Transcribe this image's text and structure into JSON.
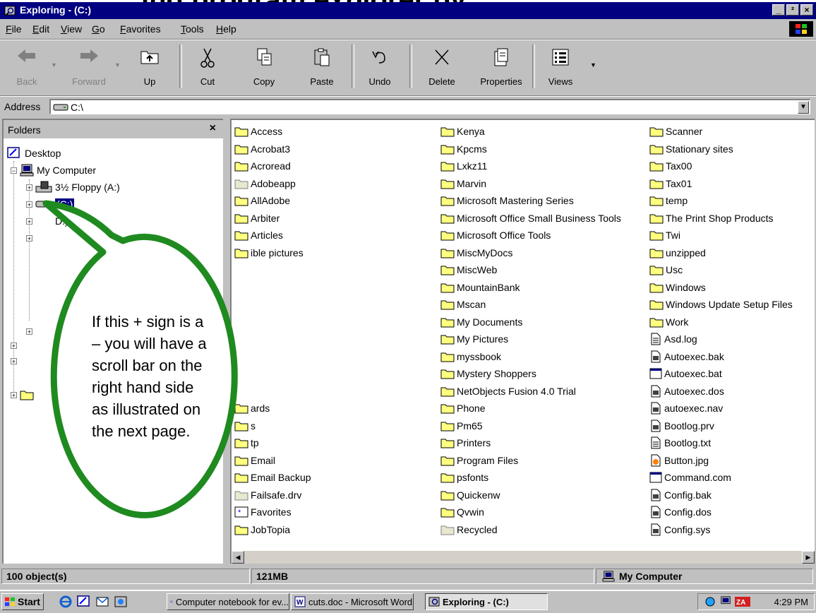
{
  "slide_heading_fragment": "ing program explorer by",
  "window": {
    "title": "Exploring -  (C:)",
    "controls": [
      "_",
      "²",
      "×"
    ]
  },
  "menu": [
    {
      "label": "File",
      "key": "F",
      "rest": "ile"
    },
    {
      "label": "Edit",
      "key": "E",
      "rest": "dit"
    },
    {
      "label": "View",
      "key": "V",
      "rest": "iew"
    },
    {
      "label": "Go",
      "key": "G",
      "rest": "o"
    },
    {
      "label": "Favorites",
      "key": "F",
      "rest": "avorites"
    },
    {
      "label": "Tools",
      "key": "T",
      "rest": "ools"
    },
    {
      "label": "Help",
      "key": "H",
      "rest": "elp"
    }
  ],
  "toolbar": {
    "back": "Back",
    "forward": "Forward",
    "up": "Up",
    "cut": "Cut",
    "copy": "Copy",
    "paste": "Paste",
    "undo": "Undo",
    "delete": "Delete",
    "properties": "Properties",
    "views": "Views"
  },
  "address": {
    "label": "Address",
    "value": "C:\\"
  },
  "folders": {
    "header": "Folders",
    "close": "×",
    "desktop": "Desktop",
    "my_computer": "My Computer",
    "floppy": "3½ Floppy (A:)",
    "c_drive": "(C:)",
    "d_drive_partial": "D:)"
  },
  "files": {
    "col1": [
      "Access",
      "Acrobat3",
      "Acroread",
      "Adobeapp",
      "AllAdobe",
      "Arbiter",
      "Articles",
      "ible pictures",
      "",
      "",
      "",
      "",
      "",
      "",
      "",
      "",
      "ards",
      "s",
      "tp",
      "Email",
      "Email Backup",
      "Failsafe.drv",
      "Favorites",
      "JobTopia"
    ],
    "col2": [
      "Kenya",
      "Kpcms",
      "Lxkz11",
      "Marvin",
      "Microsoft Mastering Series",
      "Microsoft Office Small Business Tools",
      "Microsoft Office Tools",
      "MiscMyDocs",
      "MiscWeb",
      "MountainBank",
      "Mscan",
      "My Documents",
      "My Pictures",
      "myssbook",
      "Mystery Shoppers",
      "NetObjects Fusion 4.0 Trial",
      "Phone",
      "Pm65",
      "Printers",
      "Program Files",
      "psfonts",
      "Quickenw",
      "Qvwin",
      "Recycled"
    ],
    "col3": [
      "Scanner",
      "Stationary sites",
      "Tax00",
      "Tax01",
      "temp",
      "The Print Shop Products",
      "Twi",
      "unzipped",
      "Usc",
      "Windows",
      "Windows Update Setup Files",
      "Work",
      "Asd.log",
      "Autoexec.bak",
      "Autoexec.bat",
      "Autoexec.dos",
      "autoexec.nav",
      "Bootlog.prv",
      "Bootlog.txt",
      "Button.jpg",
      "Command.com",
      "Config.bak",
      "Config.dos",
      "Config.sys"
    ]
  },
  "status": {
    "objects": "100 object(s)",
    "size": "121MB",
    "location": "My Computer"
  },
  "taskbar": {
    "start": "Start",
    "tasks": [
      "Computer notebook for ev...",
      "cuts.doc - Microsoft Word",
      "Exploring -  (C:)"
    ],
    "clock": "4:29 PM"
  },
  "callout": {
    "lines": [
      "If this + sign is a",
      "– you will have a",
      "scroll bar on the",
      "right hand side",
      "as illustrated on",
      "the next page."
    ]
  },
  "colors": {
    "title_bar": "#000080",
    "face": "#c0c0c0",
    "folder": "#ffff80",
    "callout_border": "#1f8a1f"
  }
}
